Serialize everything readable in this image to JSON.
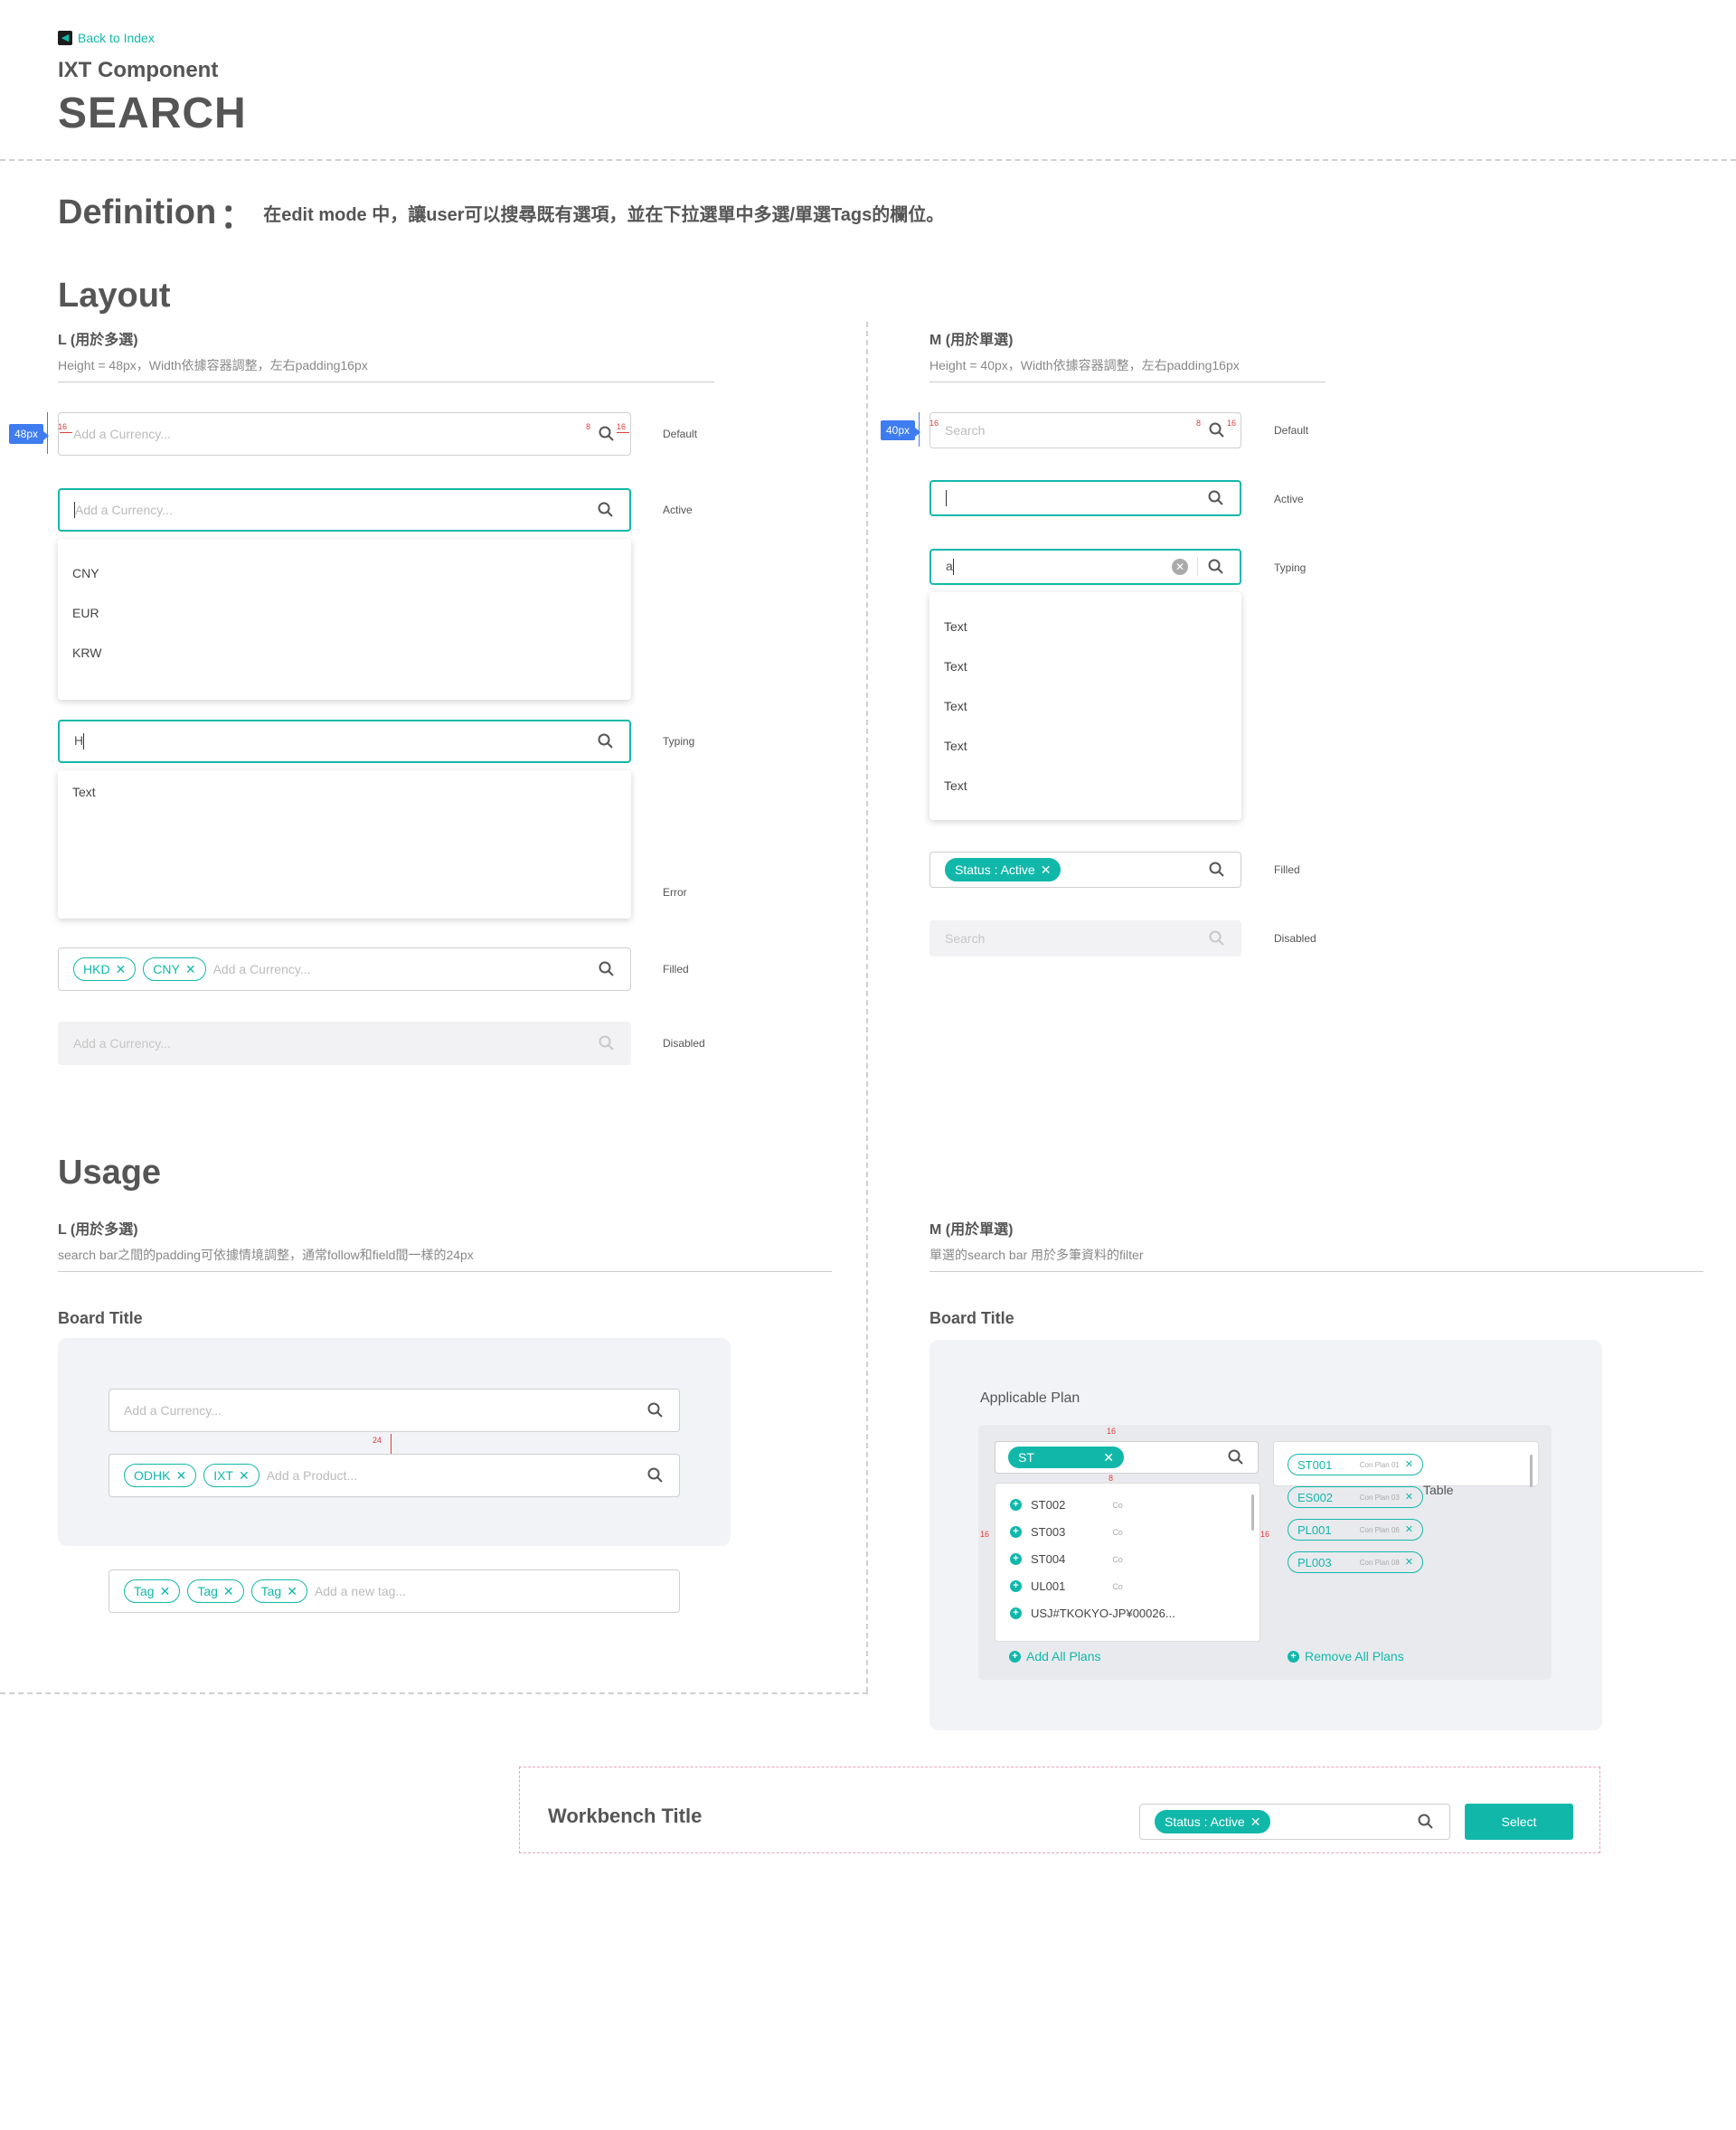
{
  "header": {
    "back": "Back to Index",
    "subtitle": "IXT Component",
    "title": "SEARCH"
  },
  "definition": {
    "title": "Definition",
    "colon": "：",
    "text": "在edit mode 中，讓user可以搜尋既有選項，並在下拉選單中多選/單選Tags的欄位。"
  },
  "layout": {
    "title": "Layout",
    "L": {
      "heading": "L (用於多選)",
      "desc": "Height = 48px，Width依據容器調整，左右padding16px",
      "height_badge": "48px",
      "pad": "16",
      "pad_small": "8",
      "placeholder": "Add a Currency...",
      "states": {
        "default": "Default",
        "active": "Active",
        "typing": "Typing",
        "error": "Error",
        "filled": "Filled",
        "disabled": "Disabled"
      },
      "options": [
        "CNY",
        "EUR",
        "KRW"
      ],
      "typing_value": "H",
      "typing_result": "Text",
      "tags": [
        "HKD",
        "CNY"
      ]
    },
    "M": {
      "heading": "M (用於單選)",
      "desc": "Height = 40px，Width依據容器調整，左右padding16px",
      "height_badge": "40px",
      "pad": "16",
      "pad_small": "8",
      "placeholder": "Search",
      "states": {
        "default": "Default",
        "active": "Active",
        "typing": "Typing",
        "filled": "Filled",
        "disabled": "Disabled"
      },
      "typing_value": "a",
      "options": [
        "Text",
        "Text",
        "Text",
        "Text",
        "Text"
      ],
      "tag": "Status : Active"
    }
  },
  "usage": {
    "title": "Usage",
    "L": {
      "heading": "L (用於多選)",
      "desc": "search bar之間的padding可依據情境調整，通常follow和field間一樣的24px",
      "board_title": "Board Title",
      "field1_placeholder": "Add a Currency...",
      "spacing": "24",
      "field2_tags": [
        "ODHK",
        "IXT"
      ],
      "field2_placeholder": "Add a Product...",
      "tag_field_tags": [
        "Tag",
        "Tag",
        "Tag"
      ],
      "tag_field_placeholder": "Add a new tag..."
    },
    "M": {
      "heading": "M (用於單選)",
      "desc": "單選的search bar 用於多筆資料的filter",
      "board_title": "Board Title",
      "applicable_plan": "Applicable Plan",
      "search_tag": "ST",
      "gap_top": "16",
      "gap_mid": "8",
      "gap_side": "16",
      "list": [
        "ST002",
        "ST003",
        "ST004",
        "UL001",
        "USJ#TKOKYO-JP¥00026..."
      ],
      "list_sub": "Co",
      "selected": [
        {
          "code": "ST001",
          "sub": "Con Plan 01"
        },
        {
          "code": "ES002",
          "sub": "Con Plan 03"
        },
        {
          "code": "PL001",
          "sub": "Con Plan 06"
        },
        {
          "code": "PL003",
          "sub": "Con Plan 08"
        }
      ],
      "table_label": "Table",
      "add_all": "Add All Plans",
      "remove_all": "Remove All Plans"
    }
  },
  "workbench": {
    "title": "Workbench Title",
    "tag": "Status : Active",
    "button": "Select"
  },
  "colors": {
    "accent": "#11b8aa",
    "measure": "#3e7cf0",
    "spacing_mark": "#e23b3b",
    "board_bg": "#f2f3f6"
  },
  "icons": [
    "search-icon",
    "close-icon",
    "clear-icon",
    "plus-icon",
    "back-arrow-icon"
  ]
}
